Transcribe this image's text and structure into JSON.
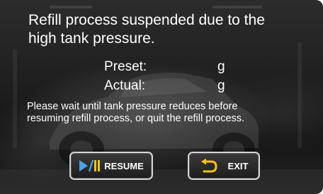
{
  "dialog": {
    "title_lines": [
      "Refill process suspended due to the",
      "high tank pressure."
    ],
    "preset": {
      "label": "Preset:",
      "unit": "g"
    },
    "actual": {
      "label": "Actual:",
      "unit": "g"
    },
    "message_lines": [
      "Please wait until tank pressure reduces before",
      "resuming refill process, or quit the refill process."
    ]
  },
  "buttons": {
    "resume": {
      "label": "RESUME",
      "icon": "play-pause-icon",
      "icon_color": "#4aa3e8"
    },
    "exit": {
      "label": "EXIT",
      "icon": "return-arrow-icon",
      "icon_color": "#f2c418"
    }
  },
  "colors": {
    "text": "#ffffff",
    "button_border": "#d4d4d4",
    "background": "#1e1e1e"
  }
}
